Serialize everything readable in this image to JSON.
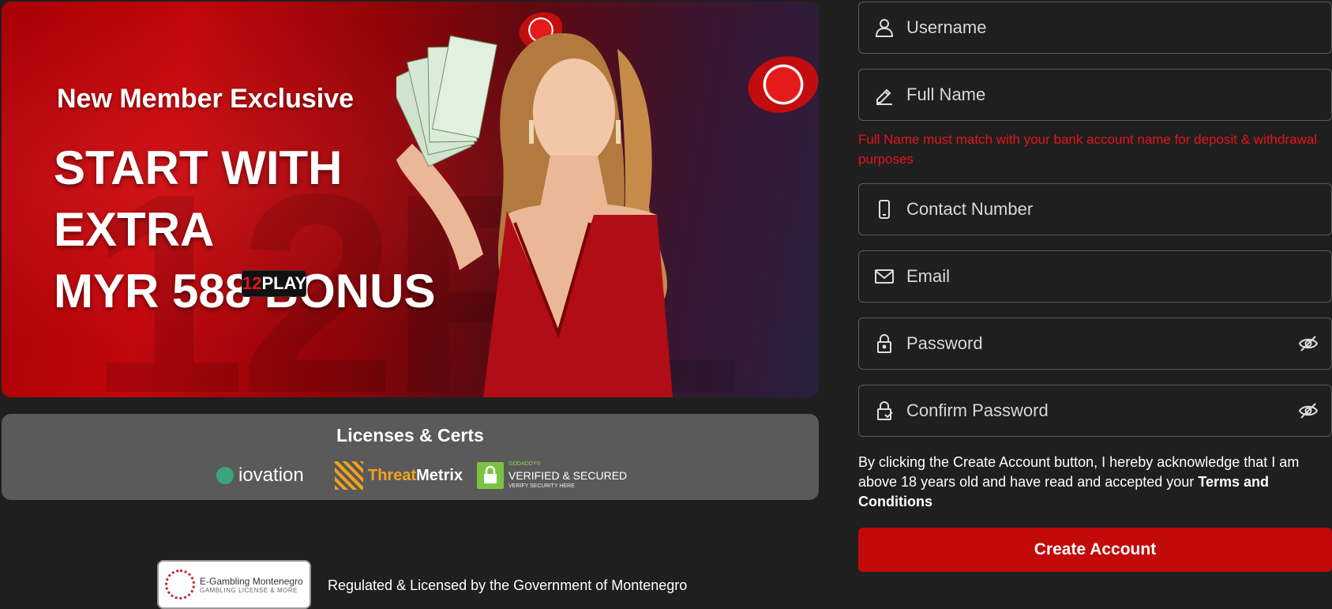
{
  "banner": {
    "kicker": "New Member Exclusive",
    "headline_lines": [
      "START WITH",
      "EXTRA",
      "MYR 588 BONUS"
    ],
    "watermark": "12PL",
    "badge_num": "12",
    "badge_word": "PLAY"
  },
  "licenses": {
    "title": "Licenses & Certs",
    "logos": {
      "iovation": "iovation",
      "threatmetrix_a": "Threat",
      "threatmetrix_b": "Metrix",
      "godaddy_top": "GODADDY®",
      "godaddy_main": "VERIFIED & SECURED",
      "godaddy_sub": "VERIFY SECURITY HERE"
    }
  },
  "footer": {
    "eg_title": "E-Gambling Montenegro",
    "eg_sub": "GAMBLING LICENSE & MORE",
    "regulated": "Regulated & Licensed by the Government of Montenegro"
  },
  "form": {
    "username": {
      "placeholder": "Username",
      "icon": "user-icon"
    },
    "fullname": {
      "placeholder": "Full Name",
      "icon": "pen-icon"
    },
    "fullname_hint": "Full Name must match with your bank account name for deposit & withdrawal purposes",
    "contact": {
      "placeholder": "Contact Number",
      "icon": "phone-icon"
    },
    "email": {
      "placeholder": "Email",
      "icon": "mail-icon"
    },
    "password": {
      "placeholder": "Password",
      "icon": "lock-icon"
    },
    "confirm_password": {
      "placeholder": "Confirm Password",
      "icon": "lock-check-icon"
    },
    "terms_text": "By clicking the Create Account button, I hereby acknowledge that I am above 18 years old and have read and accepted your ",
    "terms_link": "Terms and Conditions",
    "submit_label": "Create Account"
  },
  "colors": {
    "accent": "#c20a0a",
    "error": "#e3141b",
    "background": "#1f1f1f",
    "panel": "#5a5a5a"
  }
}
